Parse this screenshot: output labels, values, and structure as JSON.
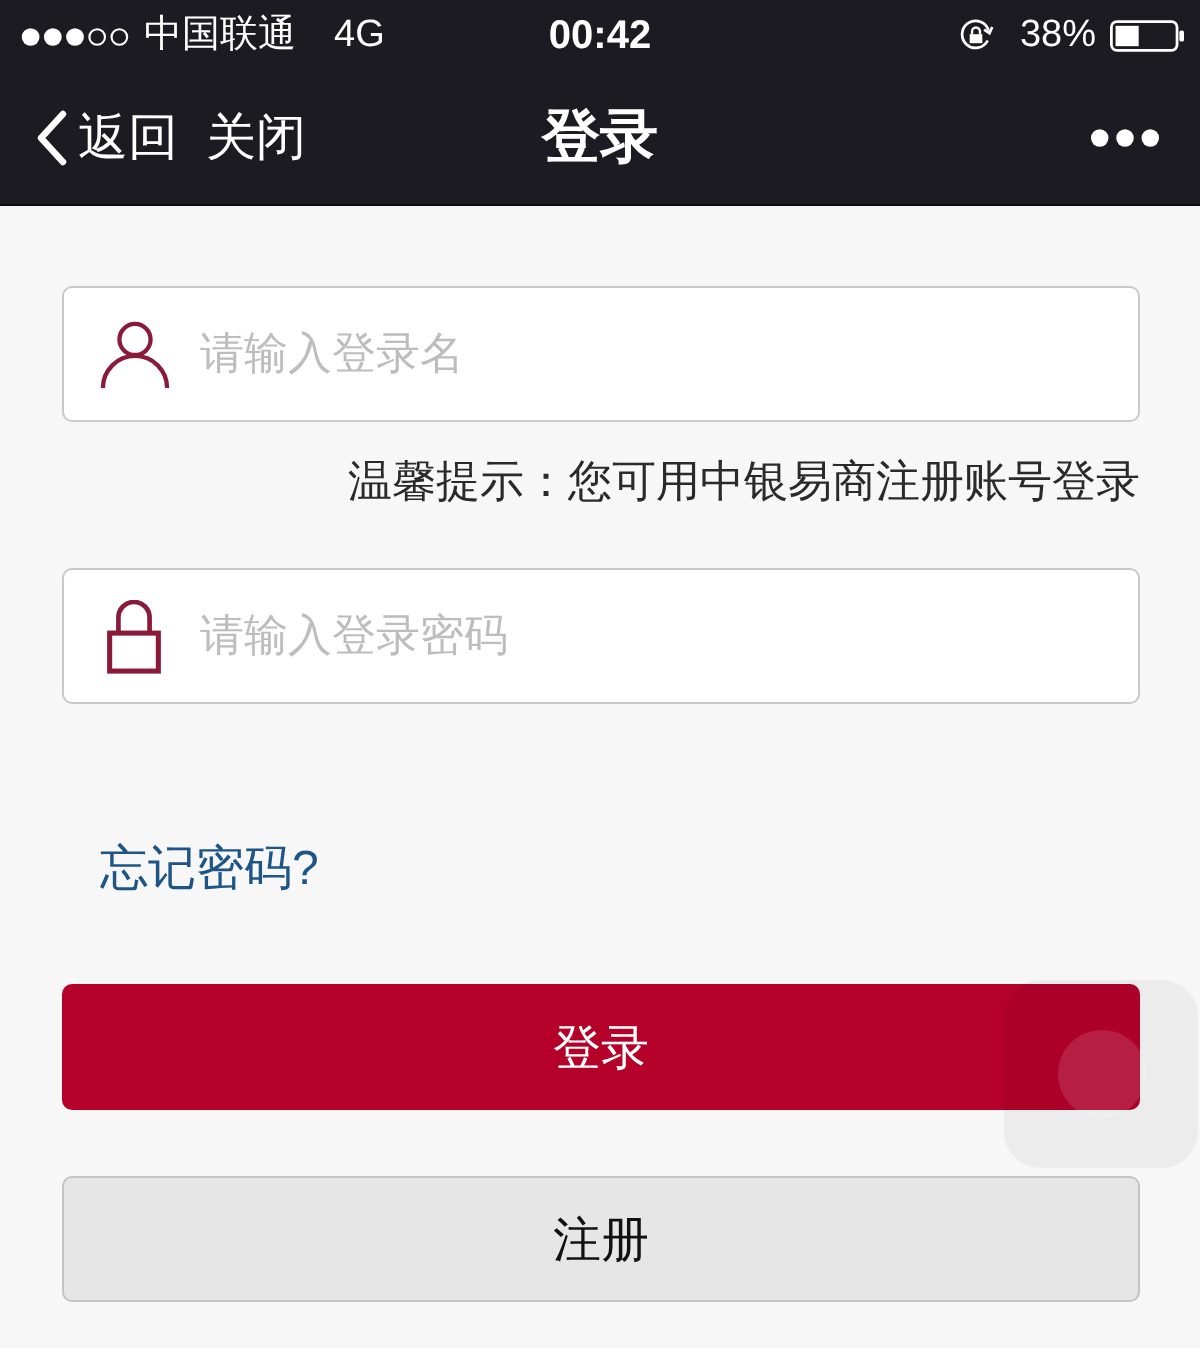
{
  "status_bar": {
    "carrier": "中国联通",
    "network": "4G",
    "time": "00:42",
    "battery": "38%"
  },
  "nav_bar": {
    "back": "返回",
    "close": "关闭",
    "title": "登录"
  },
  "fields": [
    {
      "kind": "username",
      "placeholder": "请输入登录名",
      "hint": "温馨提示：您可用中银易商注册账号登录"
    },
    {
      "kind": "password",
      "placeholder": "请输入登录密码"
    }
  ],
  "forgot_link": "忘记密码?",
  "buttons": [
    {
      "kind": "primary",
      "label": "登录"
    },
    {
      "kind": "secondary",
      "label": "注册"
    }
  ]
}
